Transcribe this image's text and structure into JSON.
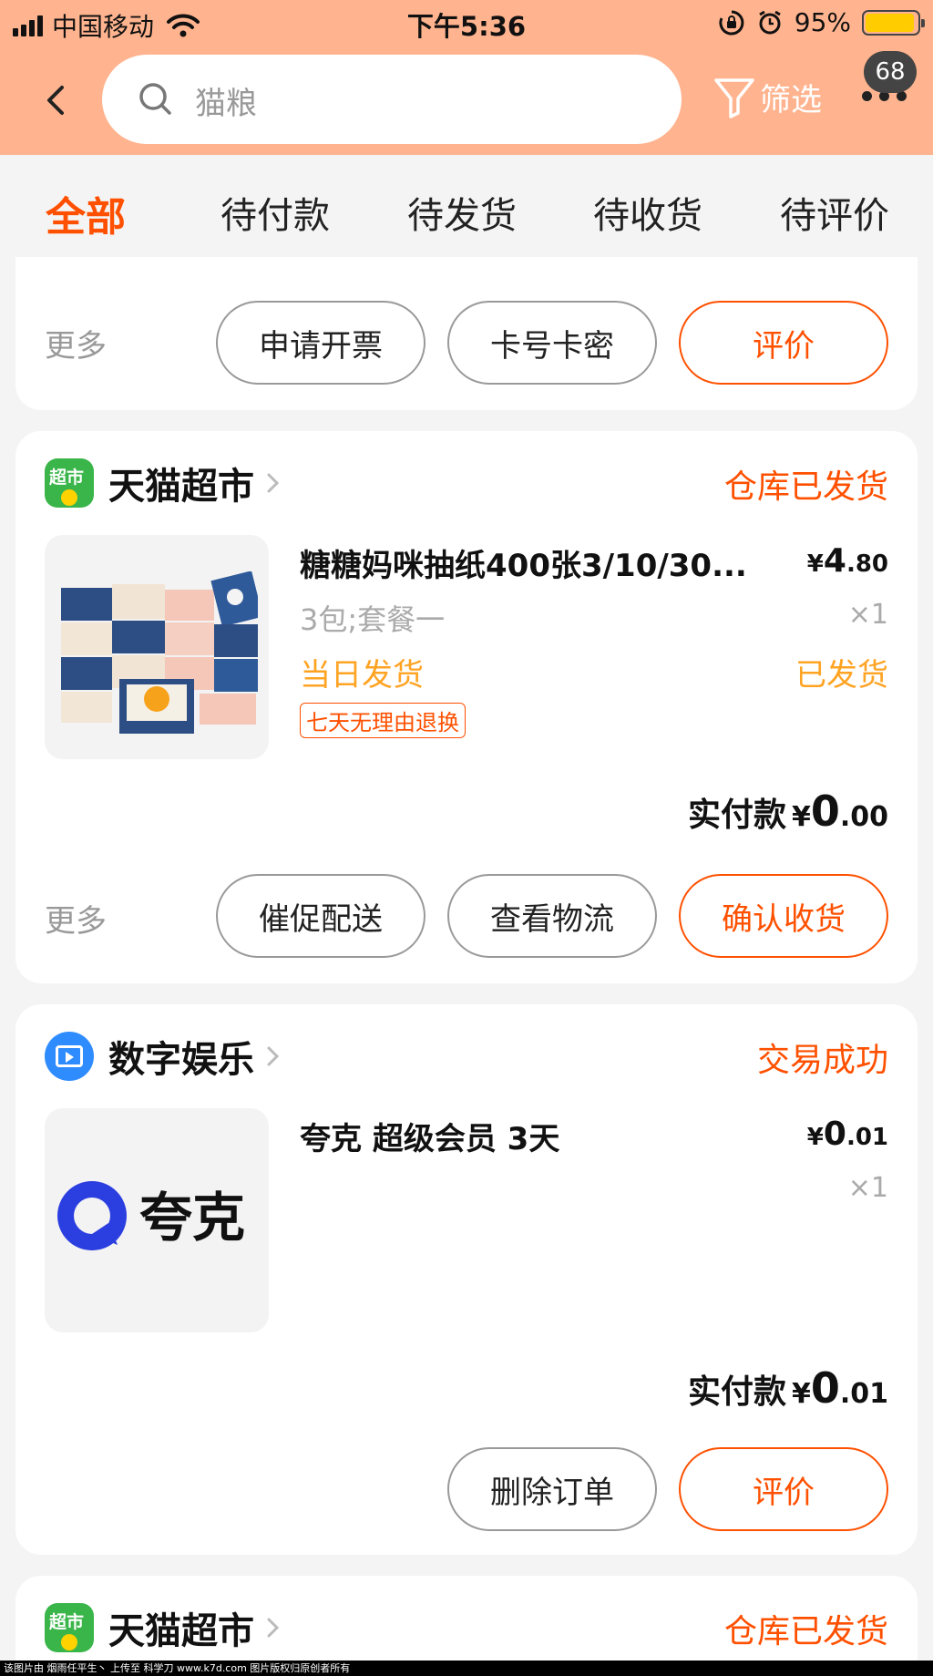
{
  "status_bar": {
    "carrier": "中国移动",
    "time": "下午5:36",
    "battery": "95%",
    "battery_level": 0.95
  },
  "header": {
    "search_text": "猫粮",
    "filter_label": "筛选",
    "badge_count": "68"
  },
  "tabs": [
    {
      "label": "全部",
      "active": true
    },
    {
      "label": "待付款",
      "active": false
    },
    {
      "label": "待发货",
      "active": false
    },
    {
      "label": "待收货",
      "active": false
    },
    {
      "label": "待评价",
      "active": false
    }
  ],
  "card0": {
    "more": "更多",
    "buttons": [
      "申请开票",
      "卡号卡密",
      "评价"
    ]
  },
  "card1": {
    "shop": "天猫超市",
    "status": "仓库已发货",
    "title": "糖糖妈咪抽纸400张3/10/30...",
    "price_yen": "¥",
    "price_int": "4",
    "price_dec": ".80",
    "sku": "3包;套餐一",
    "qty": "×1",
    "ship_tag": "当日发货",
    "ship_status": "已发货",
    "return_tag": "七天无理由退换",
    "paid_label": "实付款",
    "paid_yen": "¥",
    "paid_int": "0",
    "paid_dec": ".00",
    "more": "更多",
    "buttons": [
      "催促配送",
      "查看物流",
      "确认收货"
    ]
  },
  "card2": {
    "shop": "数字娱乐",
    "status": "交易成功",
    "title": "夸克 超级会员 3天",
    "logo_text": "夸克",
    "price_yen": "¥",
    "price_int": "0",
    "price_dec": ".01",
    "qty": "×1",
    "paid_label": "实付款",
    "paid_yen": "¥",
    "paid_int": "0",
    "paid_dec": ".01",
    "buttons": [
      "删除订单",
      "评价"
    ]
  },
  "card3": {
    "shop": "天猫超市",
    "status": "仓库已发货"
  },
  "footer": "该图片由 烟雨任平生丶 上传至 科学刀 www.k7d.com 图片版权归原创者所有",
  "colors": {
    "accent": "#ff5000",
    "header_bg": "#ffb48f",
    "ship_orange": "#ffa323"
  }
}
